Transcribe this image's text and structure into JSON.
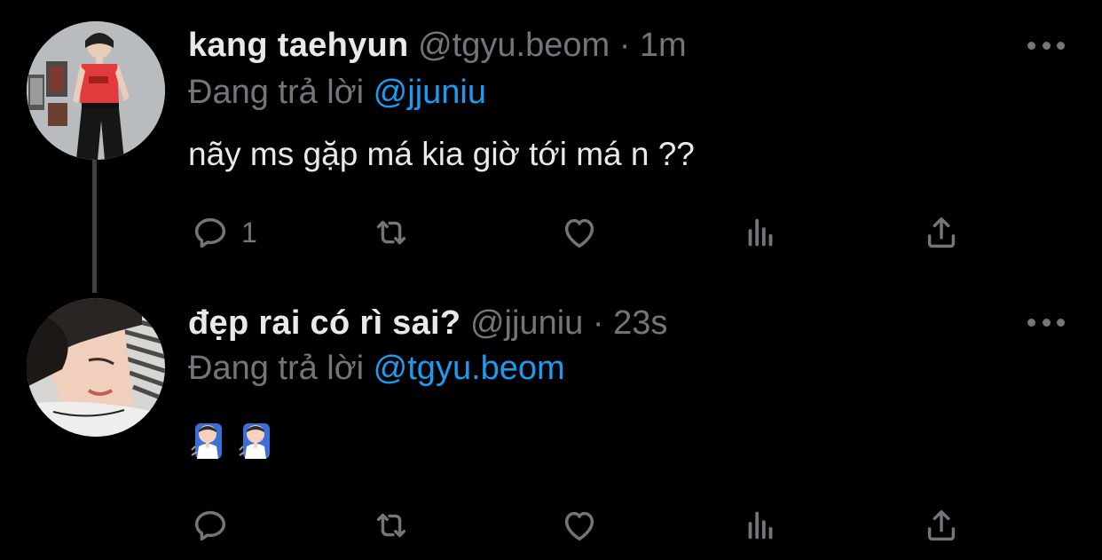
{
  "theme": {
    "background": "#000000",
    "primary_text": "#e7e9ea",
    "secondary_text": "#71767b",
    "link": "#1d9bf0",
    "thread_line": "#3e4144"
  },
  "tweets": [
    {
      "display_name": "kang taehyun",
      "handle": "@tgyu.beom",
      "separator": "·",
      "timestamp": "1m",
      "replying_prefix": "Đang trả lời",
      "replying_to": "@jjuniu",
      "text": "nãy ms gặp má kia giờ tới má n ??",
      "reply_count": "1",
      "avatar_icon": "avatar-photo",
      "icons": [
        "reply-icon",
        "retweet-icon",
        "like-icon",
        "views-icon",
        "share-icon",
        "more-icon"
      ]
    },
    {
      "display_name": "đẹp rai có rì sai?",
      "handle": "@jjuniu",
      "separator": "·",
      "timestamp": "23s",
      "replying_prefix": "Đang trả lời",
      "replying_to": "@tgyu.beom",
      "emoji": [
        "shushing-person-emoji",
        "shushing-person-emoji"
      ],
      "reply_count": "",
      "avatar_icon": "avatar-photo",
      "icons": [
        "reply-icon",
        "retweet-icon",
        "like-icon",
        "views-icon",
        "share-icon",
        "more-icon"
      ]
    }
  ]
}
